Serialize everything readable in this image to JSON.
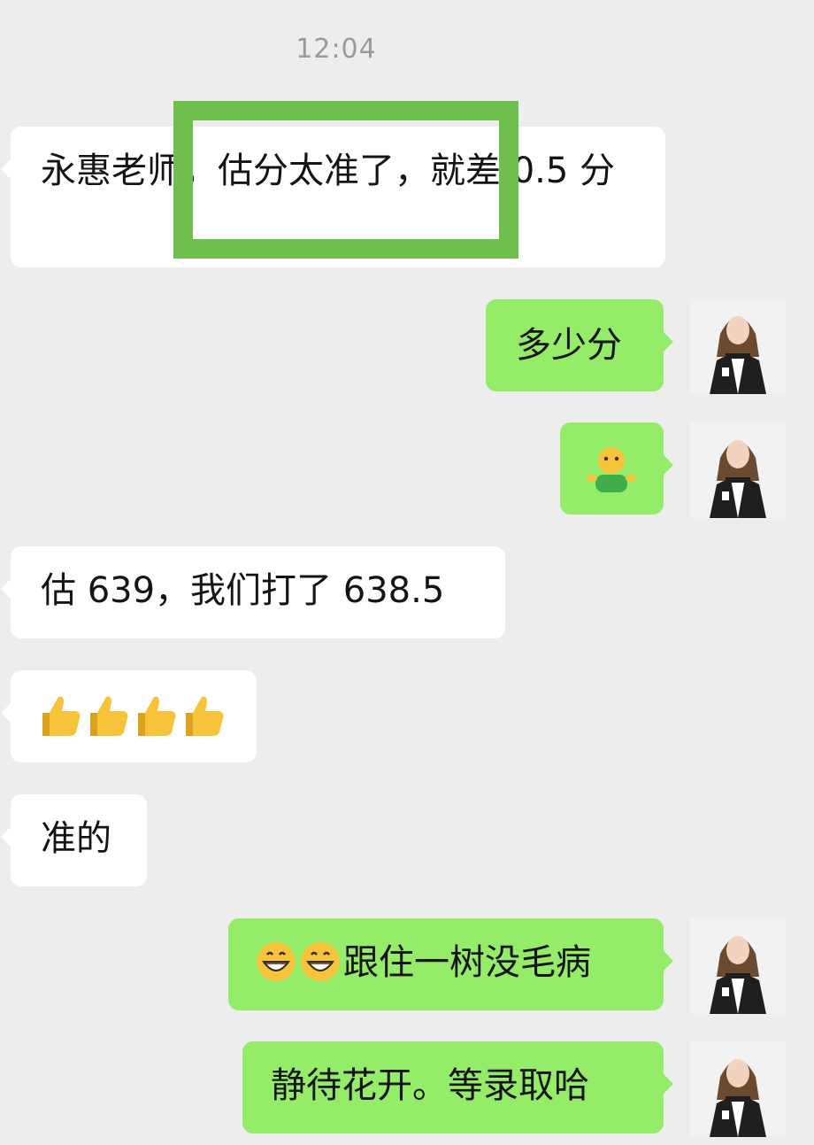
{
  "chat": {
    "timestamp": "12:04",
    "messages": [
      {
        "side": "left",
        "text": "永惠老师，估分太准了，就差 0.5 分"
      },
      {
        "side": "right",
        "text": "多少分"
      },
      {
        "side": "right",
        "emoji": "shrugging-face-emoji"
      },
      {
        "side": "left",
        "text": "估 639，我们打了 638.5"
      },
      {
        "side": "left",
        "emoji": "thumbs-up-emoji x4"
      },
      {
        "side": "left",
        "text": "准的"
      },
      {
        "side": "right",
        "text": "跟住一树没毛病",
        "leading_emoji": "grinning-face-emoji x2"
      },
      {
        "side": "right",
        "text": "静待花开。等录取哈"
      }
    ],
    "highlight_color": "#6fbf4f",
    "outgoing_bubble_color": "#95ec69",
    "incoming_bubble_color": "#ffffff",
    "background_color": "#ededed"
  }
}
